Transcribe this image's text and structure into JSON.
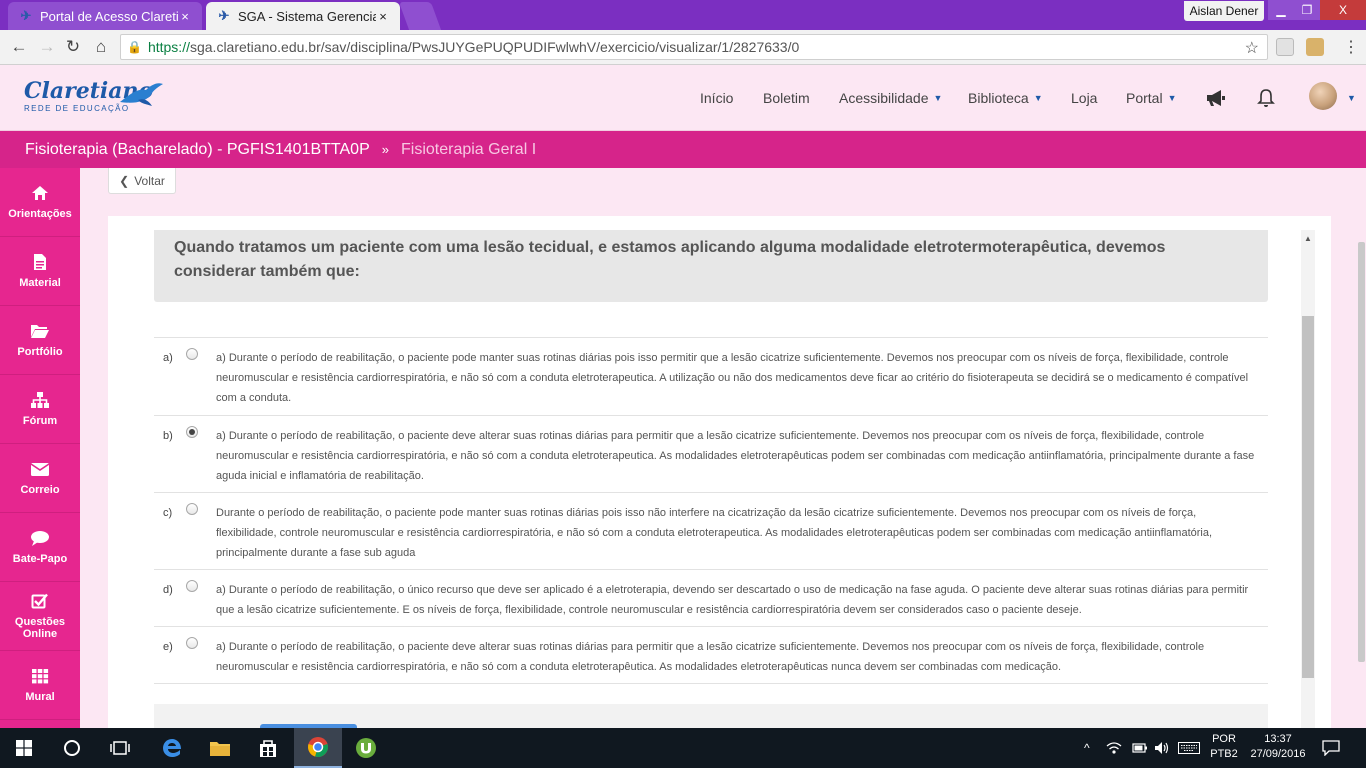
{
  "browser": {
    "tabs": [
      {
        "label": "Portal de Acesso Claretia",
        "close": "×"
      },
      {
        "label": "SGA - Sistema Gerenciad",
        "close": "×"
      }
    ],
    "user": "Aislan Dener",
    "window": {
      "minimize": "▁",
      "maximize": "❐",
      "close": "X"
    },
    "url_scheme": "https://",
    "url_rest": "sga.claretiano.edu.br/sav/disciplina/PwsJUYGePUQPUDIFwlwhV/exercicio/visualizar/1/2827633/0"
  },
  "site": {
    "logo": "Claretiano",
    "logo_sub": "REDE DE EDUCAÇÃO",
    "nav": [
      {
        "label": "Início",
        "caret": ""
      },
      {
        "label": "Boletim",
        "caret": ""
      },
      {
        "label": "Acessibilidade",
        "caret": "▼"
      },
      {
        "label": "Biblioteca",
        "caret": "▼"
      },
      {
        "label": "Loja",
        "caret": ""
      },
      {
        "label": "Portal",
        "caret": "▼"
      }
    ],
    "avatar_caret": "▼"
  },
  "breadcrumb": {
    "course": "Fisioterapia (Bacharelado) - PGFIS1401BTTA0P",
    "separator": "»",
    "discipline": "Fisioterapia Geral I"
  },
  "sidebar": {
    "items": [
      {
        "label": "Orientações",
        "icon": "home-icon"
      },
      {
        "label": "Material",
        "icon": "document-icon"
      },
      {
        "label": "Portfólio",
        "icon": "folder-icon"
      },
      {
        "label": "Fórum",
        "icon": "sitemap-icon"
      },
      {
        "label": "Correio",
        "icon": "envelope-icon"
      },
      {
        "label": "Bate-Papo",
        "icon": "chat-icon"
      },
      {
        "label": "Questões Online",
        "icon": "checkbox-icon"
      },
      {
        "label": "Mural",
        "icon": "grid-icon"
      }
    ]
  },
  "content": {
    "back_label": "Voltar",
    "question": "Quando tratamos um paciente com uma lesão tecidual, e estamos aplicando alguma modalidade eletrotermoterapêutica, devemos considerar também que:",
    "selected_option": "b)",
    "options": [
      {
        "letter": "a)",
        "text": "a)      Durante o período de reabilitação, o paciente pode manter suas rotinas diárias pois isso permitir que a lesão cicatrize suficientemente. Devemos nos preocupar com os níveis de força, flexibilidade, controle neuromuscular e resistência cardiorrespiratória, e não só com a conduta eletroterapeutica. A utilização ou não dos medicamentos deve ficar ao critério do fisioterapeuta se decidirá se o medicamento é compatível com a conduta."
      },
      {
        "letter": "b)",
        "text": "a)      Durante o período de reabilitação, o paciente deve alterar suas rotinas diárias para permitir que a lesão cicatrize suficientemente. Devemos nos preocupar com os níveis de força, flexibilidade, controle neuromuscular e resistência cardiorrespiratória, e não só com a conduta eletroterapeutica. As modalidades eletroterapêuticas podem ser combinadas com medicação antiinflamatória, principalmente durante a fase aguda inicial e inflamatória de reabilitação."
      },
      {
        "letter": "c)",
        "text": "Durante o período de reabilitação, o paciente pode manter suas rotinas diárias pois isso não interfere na cicatrização da lesão cicatrize suficientemente. Devemos nos preocupar com os níveis de força, flexibilidade, controle neuromuscular e resistência cardiorrespiratória, e não só com a conduta eletroterapeutica. As modalidades eletroterapêuticas podem ser combinadas com medicação antiinflamatória, principalmente durante a fase sub aguda"
      },
      {
        "letter": "d)",
        "text": "a)      Durante o período de reabilitação, o único recurso que deve ser aplicado é a eletroterapia, devendo ser descartado o uso de medicação na fase aguda. O paciente deve alterar suas rotinas diárias para permitir que a lesão cicatrize suficientemente. E os níveis de força, flexibilidade, controle neuromuscular e resistência cardiorrespiratória devem ser considerados caso o paciente deseje."
      },
      {
        "letter": "e)",
        "text": "a)      Durante o período de reabilitação, o paciente deve alterar suas rotinas diárias para permitir que a lesão cicatrize suficientemente. Devemos nos preocupar com os níveis de força, flexibilidade, controle neuromuscular e resistência cardiorrespiratória, e não só com a conduta eletroterapêutica. As modalidades eletroterapêuticas nunca devem ser combinadas com medicação."
      }
    ]
  },
  "taskbar": {
    "lang_1": "POR",
    "lang_2": "PTB2",
    "time": "13:37",
    "date": "27/09/2016"
  },
  "colors": {
    "brand_pink": "#e6268f",
    "breadcrumb_pink": "#d6248a",
    "brand_blue": "#1e5aa8",
    "titlebar_purple": "#7b2fc1"
  }
}
